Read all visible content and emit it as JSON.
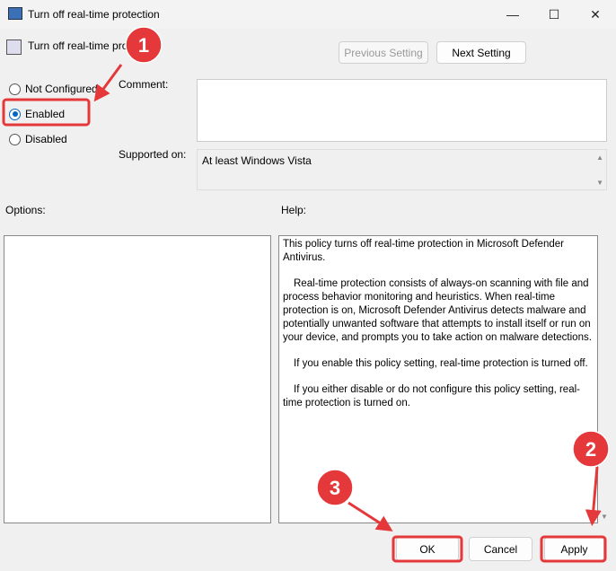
{
  "window": {
    "title": "Turn off real-time protection",
    "minimize": "—",
    "maximize": "☐",
    "close": "✕"
  },
  "header": {
    "title": "Turn off real-time protection",
    "prev_label": "Previous Setting",
    "next_label": "Next Setting"
  },
  "state": {
    "options": [
      "Not Configured",
      "Enabled",
      "Disabled"
    ],
    "selected": "Enabled"
  },
  "comment": {
    "label": "Comment:",
    "value": ""
  },
  "supported": {
    "label": "Supported on:",
    "value": "At least Windows Vista"
  },
  "options_label": "Options:",
  "help": {
    "label": "Help:",
    "paragraphs": [
      "This policy turns off real-time protection in Microsoft Defender Antivirus.",
      "Real-time protection consists of always-on scanning with file and process behavior monitoring and heuristics. When real-time protection is on, Microsoft Defender Antivirus detects malware and potentially unwanted software that attempts to install itself or run on your device, and prompts you to take action on malware detections.",
      "If you enable this policy setting, real-time protection is turned off.",
      "If you either disable or do not configure this policy setting, real-time protection is turned on."
    ]
  },
  "footer": {
    "ok": "OK",
    "cancel": "Cancel",
    "apply": "Apply"
  },
  "annotations": {
    "steps": [
      "1",
      "2",
      "3"
    ],
    "color": "#e5383b"
  }
}
